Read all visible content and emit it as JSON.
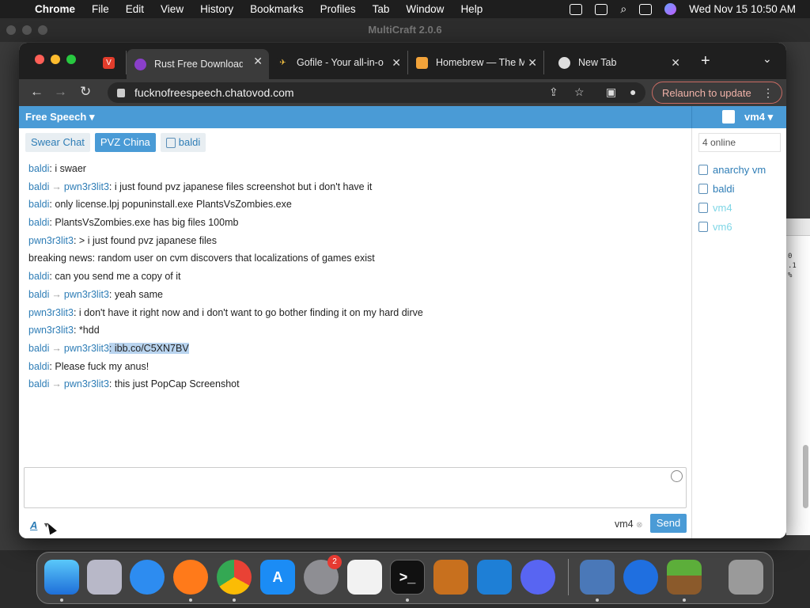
{
  "menubar": {
    "app": "Chrome",
    "items": [
      "File",
      "Edit",
      "View",
      "History",
      "Bookmarks",
      "Profiles",
      "Tab",
      "Window",
      "Help"
    ],
    "clock": "Wed Nov 15  10:50 AM"
  },
  "background_window": {
    "title": "MultiCraft 2.0.6",
    "text": "0\n.1\n%"
  },
  "browser": {
    "tabs": [
      {
        "label": "",
        "icon": "vivaldi-icon"
      },
      {
        "label": "Rust Free Download",
        "icon": "tor-icon"
      },
      {
        "label": "Gofile - Your all-in-o",
        "icon": "gofile-icon"
      },
      {
        "label": "Homebrew — The M",
        "icon": "homebrew-icon"
      },
      {
        "label": "New Tab",
        "icon": "chrome-icon"
      }
    ],
    "url": "fucknofreespeech.chatovod.com",
    "relaunch_label": "Relaunch to update"
  },
  "chat": {
    "room_title": "Free Speech",
    "current_user": "vm4",
    "tabs": [
      {
        "label": "Swear Chat"
      },
      {
        "label": "PVZ China"
      },
      {
        "label": "baldi"
      }
    ],
    "messages": [
      {
        "from": "baldi",
        "to": "",
        "text": ": i swaer"
      },
      {
        "from": "baldi",
        "to": "pwn3r3lit3",
        "text": ": i just found pvz japanese files screenshot but i don't have it"
      },
      {
        "from": "baldi",
        "to": "",
        "text": ": only license.lpj popuninstall.exe PlantsVsZombies.exe"
      },
      {
        "from": "baldi",
        "to": "",
        "text": ": PlantsVsZombies.exe has big files 100mb"
      },
      {
        "from": "pwn3r3lit3",
        "to": "",
        "text": ": > i just found pvz japanese files"
      },
      {
        "from": "",
        "to": "",
        "text": "breaking news: random user on cvm discovers that localizations of games exist"
      },
      {
        "from": "baldi",
        "to": "",
        "text": ": can you send me a copy of it"
      },
      {
        "from": "baldi",
        "to": "pwn3r3lit3",
        "text": ": yeah same"
      },
      {
        "from": "pwn3r3lit3",
        "to": "",
        "text": ": i don't have it right now and i don't want to go bother finding it on my hard dirve"
      },
      {
        "from": "pwn3r3lit3",
        "to": "",
        "text": ": *hdd"
      },
      {
        "from": "baldi",
        "to": "pwn3r3lit3",
        "text": ": ibb.co/C5XN7BV"
      },
      {
        "from": "baldi",
        "to": "",
        "text": ": Please fuck my anus!"
      },
      {
        "from": "baldi",
        "to": "pwn3r3lit3",
        "text": ": this just PopCap Screenshot"
      }
    ],
    "arrow": "→",
    "format_label": "A",
    "bottom_user": "vm4",
    "send_label": "Send",
    "online_label": "4 online",
    "users": [
      {
        "name": "anarchy vm",
        "status": "active"
      },
      {
        "name": "baldi",
        "status": "active"
      },
      {
        "name": "vm4",
        "status": "idle"
      },
      {
        "name": "vm6",
        "status": "idle"
      }
    ]
  },
  "dock": {
    "settings_badge": "2",
    "apps": [
      "finder-icon",
      "launchpad-icon",
      "safari-icon",
      "firefox-icon",
      "chrome-icon",
      "app-store-icon",
      "system-settings-icon",
      "textedit-icon",
      "terminal-icon",
      "garageband-icon",
      "vscode-icon",
      "discord-icon",
      "virtualbox-icon",
      "game-controller-icon",
      "minecraft-icon",
      "trash-icon"
    ]
  }
}
